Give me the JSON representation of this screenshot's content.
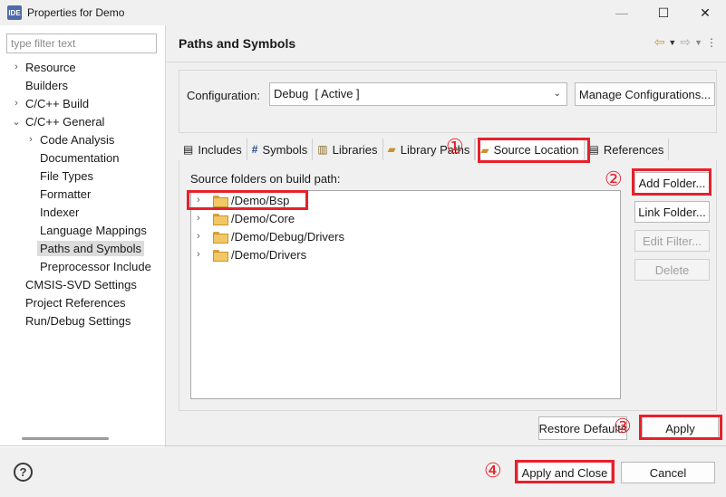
{
  "window": {
    "app_badge": "IDE",
    "title": "Properties for Demo",
    "minimize": "—",
    "maximize": "☐",
    "close": "✕"
  },
  "sidebar": {
    "filter_placeholder": "type filter text",
    "items": [
      {
        "label": "Resource",
        "twisty": "›"
      },
      {
        "label": "Builders",
        "twisty": ""
      },
      {
        "label": "C/C++ Build",
        "twisty": "›"
      },
      {
        "label": "C/C++ General",
        "twisty": "⌄"
      },
      {
        "label": "Code Analysis",
        "twisty": "›"
      },
      {
        "label": "Documentation",
        "twisty": ""
      },
      {
        "label": "File Types",
        "twisty": ""
      },
      {
        "label": "Formatter",
        "twisty": ""
      },
      {
        "label": "Indexer",
        "twisty": ""
      },
      {
        "label": "Language Mappings",
        "twisty": ""
      },
      {
        "label": "Paths and Symbols",
        "twisty": ""
      },
      {
        "label": "Preprocessor Include",
        "twisty": ""
      },
      {
        "label": "CMSIS-SVD Settings",
        "twisty": ""
      },
      {
        "label": "Project References",
        "twisty": ""
      },
      {
        "label": "Run/Debug Settings",
        "twisty": ""
      }
    ]
  },
  "page": {
    "title": "Paths and Symbols",
    "configuration_label": "Configuration:",
    "configuration_value": "Debug  [ Active ]",
    "manage_button": "Manage Configurations..."
  },
  "tabs": [
    {
      "label": "Includes",
      "icon": "📄"
    },
    {
      "label": "Symbols",
      "icon": "#"
    },
    {
      "label": "Libraries",
      "icon": "▥"
    },
    {
      "label": "Library Paths",
      "icon": "📂"
    },
    {
      "label": "Source Location",
      "icon": "📂"
    },
    {
      "label": "References",
      "icon": "📄"
    }
  ],
  "source": {
    "label": "Source folders on build path:",
    "folders": [
      "/Demo/Bsp",
      "/Demo/Core",
      "/Demo/Debug/Drivers",
      "/Demo/Drivers"
    ]
  },
  "side_buttons": {
    "add_folder": "Add Folder...",
    "link_folder": "Link Folder...",
    "edit_filter": "Edit Filter...",
    "delete": "Delete"
  },
  "bottom": {
    "restore_defaults": "Restore Defaults",
    "apply": "Apply",
    "apply_and_close": "Apply and Close",
    "cancel": "Cancel",
    "help": "?"
  },
  "annotations": {
    "step1": "①",
    "step2": "②",
    "step3": "③",
    "step4": "④"
  },
  "colors": {
    "highlight": "#e8202a",
    "folder": "#f2c866"
  }
}
